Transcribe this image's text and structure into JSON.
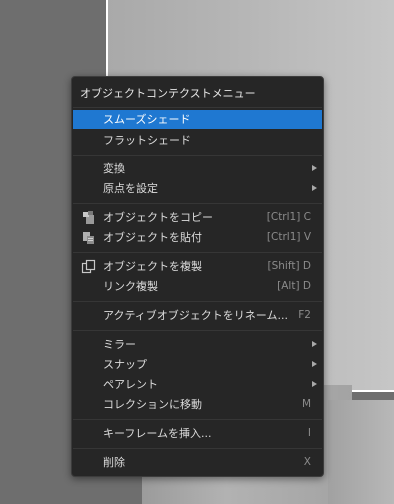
{
  "menu": {
    "title": "オブジェクトコンテクストメニュー",
    "items": [
      {
        "label": "スムーズシェード",
        "shortcut": "",
        "submenu": false,
        "icon": "",
        "highlighted": true
      },
      {
        "label": "フラットシェード",
        "shortcut": "",
        "submenu": false,
        "icon": ""
      },
      {
        "label": "変換",
        "shortcut": "",
        "submenu": true,
        "icon": ""
      },
      {
        "label": "原点を設定",
        "shortcut": "",
        "submenu": true,
        "icon": ""
      },
      {
        "label": "オブジェクトをコピー",
        "shortcut": "[Ctrl1] C",
        "submenu": false,
        "icon": "copy-objects-icon"
      },
      {
        "label": "オブジェクトを貼付",
        "shortcut": "[Ctrl1] V",
        "submenu": false,
        "icon": "paste-objects-icon"
      },
      {
        "label": "オブジェクトを複製",
        "shortcut": "[Shift] D",
        "submenu": false,
        "icon": "duplicate-icon"
      },
      {
        "label": "リンク複製",
        "shortcut": "[Alt] D",
        "submenu": false,
        "icon": ""
      },
      {
        "label": "アクティブオブジェクトをリネーム...",
        "shortcut": "F2",
        "submenu": false,
        "icon": ""
      },
      {
        "label": "ミラー",
        "shortcut": "",
        "submenu": true,
        "icon": ""
      },
      {
        "label": "スナップ",
        "shortcut": "",
        "submenu": true,
        "icon": ""
      },
      {
        "label": "ペアレント",
        "shortcut": "",
        "submenu": true,
        "icon": ""
      },
      {
        "label": "コレクションに移動",
        "shortcut": "M",
        "submenu": false,
        "icon": ""
      },
      {
        "label": "キーフレームを挿入...",
        "shortcut": "I",
        "submenu": false,
        "icon": ""
      },
      {
        "label": "削除",
        "shortcut": "X",
        "submenu": false,
        "icon": ""
      }
    ]
  },
  "colors": {
    "menu_bg": "#262626",
    "highlight": "#1f78d1",
    "text": "#dcdcdc",
    "shortcut": "#8b8b8b"
  }
}
